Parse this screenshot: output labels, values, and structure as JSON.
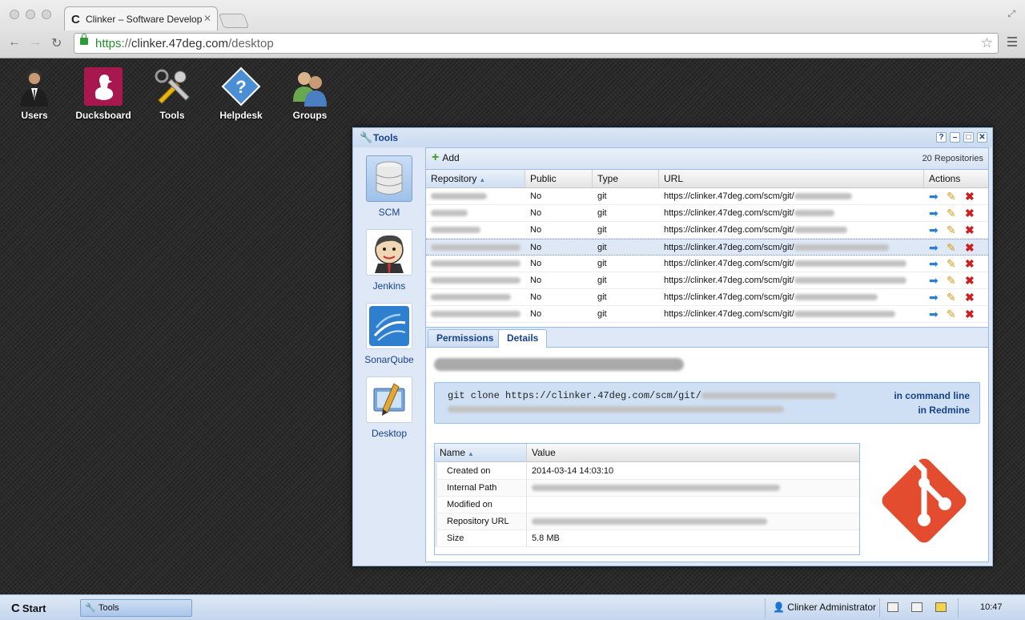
{
  "browser": {
    "tab_title": "Clinker – Software Develop",
    "url_scheme": "https",
    "url_sep": "://",
    "url_host": "clinker.47deg.com",
    "url_path": "/desktop"
  },
  "desktop_icons": [
    {
      "label": "Users",
      "icon": "users-icon"
    },
    {
      "label": "Ducksboard",
      "icon": "duck-icon"
    },
    {
      "label": "Tools",
      "icon": "tools-icon"
    },
    {
      "label": "Helpdesk",
      "icon": "helpdesk-icon"
    },
    {
      "label": "Groups",
      "icon": "groups-icon"
    }
  ],
  "window": {
    "title": "Tools",
    "tools": [
      "?",
      "–",
      "□",
      "✕"
    ],
    "sidebar": [
      {
        "label": "SCM",
        "icon": "database-icon",
        "active": true
      },
      {
        "label": "Jenkins",
        "icon": "jenkins-icon"
      },
      {
        "label": "SonarQube",
        "icon": "sonarqube-icon"
      },
      {
        "label": "Desktop",
        "icon": "desktop-icon"
      }
    ]
  },
  "grid": {
    "add_label": "Add",
    "count_label": "20 Repositories",
    "columns": [
      "Repository",
      "Public",
      "Type",
      "URL",
      "Actions"
    ],
    "url_prefix": "https://clinker.47deg.com/scm/git/",
    "rows": [
      {
        "public": "No",
        "type": "git",
        "selected": false
      },
      {
        "public": "No",
        "type": "git",
        "selected": false
      },
      {
        "public": "No",
        "type": "git",
        "selected": false
      },
      {
        "public": "No",
        "type": "git",
        "selected": true
      },
      {
        "public": "No",
        "type": "git",
        "selected": false
      },
      {
        "public": "No",
        "type": "git",
        "selected": false
      },
      {
        "public": "No",
        "type": "git",
        "selected": false
      },
      {
        "public": "No",
        "type": "git",
        "selected": false
      }
    ]
  },
  "detail": {
    "tabs": [
      "Permissions",
      "Details"
    ],
    "active_tab": "Details",
    "clone_prefix": "git clone https://clinker.47deg.com/scm/git/",
    "in_command_line": "in command line",
    "in_redmine": "in Redmine",
    "props_columns": [
      "Name",
      "Value"
    ],
    "props": [
      {
        "name": "Created on",
        "value": "2014-03-14 14:03:10"
      },
      {
        "name": "Internal Path",
        "value": ""
      },
      {
        "name": "Modified on",
        "value": ""
      },
      {
        "name": "Repository URL",
        "value": ""
      },
      {
        "name": "Size",
        "value": "5.8 MB"
      }
    ]
  },
  "taskbar": {
    "start_label": "Start",
    "task_label": "Tools",
    "user_label": "Clinker Administrator",
    "clock": "10:47"
  },
  "colors": {
    "accent": "#15428b",
    "git_logo": "#e44c2f",
    "delete": "#cc1f1f"
  }
}
